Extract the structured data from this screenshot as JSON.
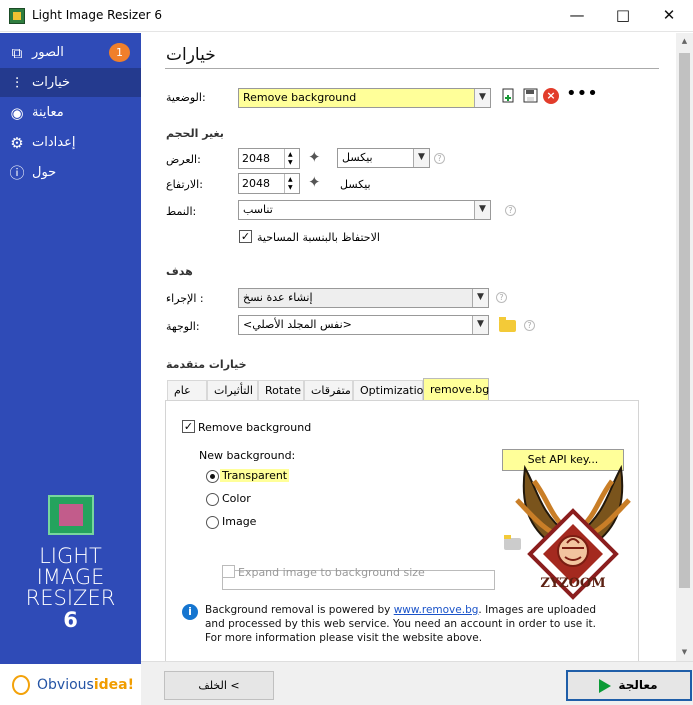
{
  "window": {
    "title": "Light Image Resizer 6",
    "minimize": "—",
    "maximize": "□",
    "close": "✕"
  },
  "sidebar": {
    "items": [
      {
        "label": "الصور",
        "icon": "⧉",
        "badge": "1"
      },
      {
        "label": "خيارات",
        "icon": "⫶",
        "active": true
      },
      {
        "label": "معاينة",
        "icon": "◉"
      },
      {
        "label": "إعدادات",
        "icon": "⚙"
      },
      {
        "label": "حول",
        "icon": "ⓘ"
      }
    ],
    "brand_lines": [
      "LIGHT",
      "IMAGE",
      "RESIZER"
    ],
    "version": "6",
    "company": {
      "prefix": "Obvious",
      "suffix": "idea!"
    }
  },
  "options": {
    "title": "خيارات",
    "profile_label": "الوضعية:",
    "profile_value": "Remove background",
    "resize_heading": "بغير الحجم",
    "width_label": "العرض:",
    "width_value": "2048",
    "height_label": "الارتفاع:",
    "height_value": "2048",
    "unit_value": "بيكسل",
    "unit_static": "بيكسل",
    "mode_label": "النمط:",
    "mode_value": "تناسب",
    "keep_ratio_label": "الاحتفاظ بالبنسبة المساحية",
    "target_heading": "هدف",
    "action_label": "الإجراء :",
    "action_value": "إنشاء عدة نسخ",
    "destination_label": "الوجهة:",
    "destination_value": "<نفس المجلد الأصلي>",
    "advanced_heading": "خيارات متقدمة"
  },
  "tabs": [
    "عام",
    "التأثيرات",
    "Rotate",
    "متفرقات",
    "Optimization",
    "remove.bg"
  ],
  "removebg": {
    "checkbox_label": "Remove background",
    "api_button": "Set API key...",
    "new_background_label": "New background:",
    "choices": [
      "Transparent",
      "Color",
      "Image"
    ],
    "expand_label": "Expand image to background size",
    "info_before_link": "Background removal is powered by ",
    "info_link": "www.remove.bg",
    "info_after_link": ". Images are uploaded and processed by this web service. You need an account in order to use it. For more information please visit the website above."
  },
  "watermark_text": "ZYZOOM",
  "footer": {
    "back": "الخلف <",
    "process": "معالجة"
  },
  "colors": {
    "sidebar": "#2f4bb7",
    "highlight": "#ffff99",
    "accent": "#f07f2b"
  },
  "icons": {
    "add_profile": "add-file-icon",
    "save_profile": "save-icon",
    "delete_profile": "delete-icon",
    "more": "more-icon",
    "magic": "magic-wand-icon"
  }
}
